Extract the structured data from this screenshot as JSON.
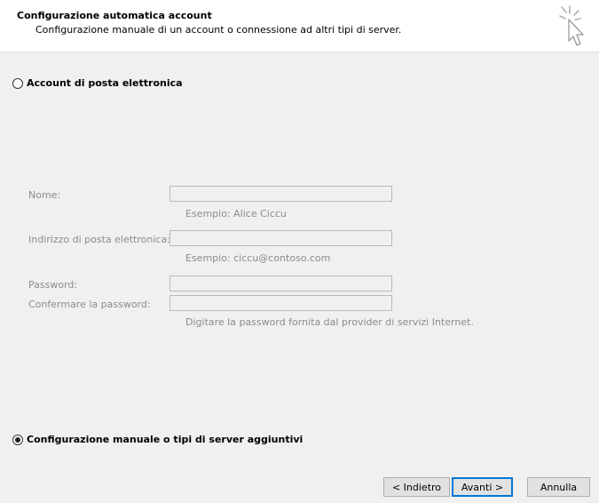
{
  "header": {
    "title": "Configurazione automatica account",
    "subtitle": "Configurazione manuale di un account o connessione ad altri tipi di server."
  },
  "options": {
    "email_account": {
      "label": "Account di posta elettronica",
      "selected": false
    },
    "manual_setup": {
      "label": "Configurazione manuale o tipi di server aggiuntivi",
      "selected": true
    }
  },
  "form": {
    "name_label": "Nome:",
    "name_value": "",
    "name_hint": "Esempio: Alice Ciccu",
    "email_label": "Indirizzo di posta elettronica:",
    "email_value": "",
    "email_hint": "Esempio: ciccu@contoso.com",
    "password_label": "Password:",
    "password_value": "",
    "confirm_label": "Confermare la password:",
    "confirm_value": "",
    "password_hint": "Digitare la password fornita dal provider di servizi Internet."
  },
  "buttons": {
    "back": "< Indietro",
    "next": "Avanti >",
    "cancel": "Annulla"
  },
  "icons": {
    "wizard": "wizard-cursor-icon"
  },
  "colors": {
    "disabled_text": "#8c8c8c",
    "primary_border": "#0078d7"
  }
}
